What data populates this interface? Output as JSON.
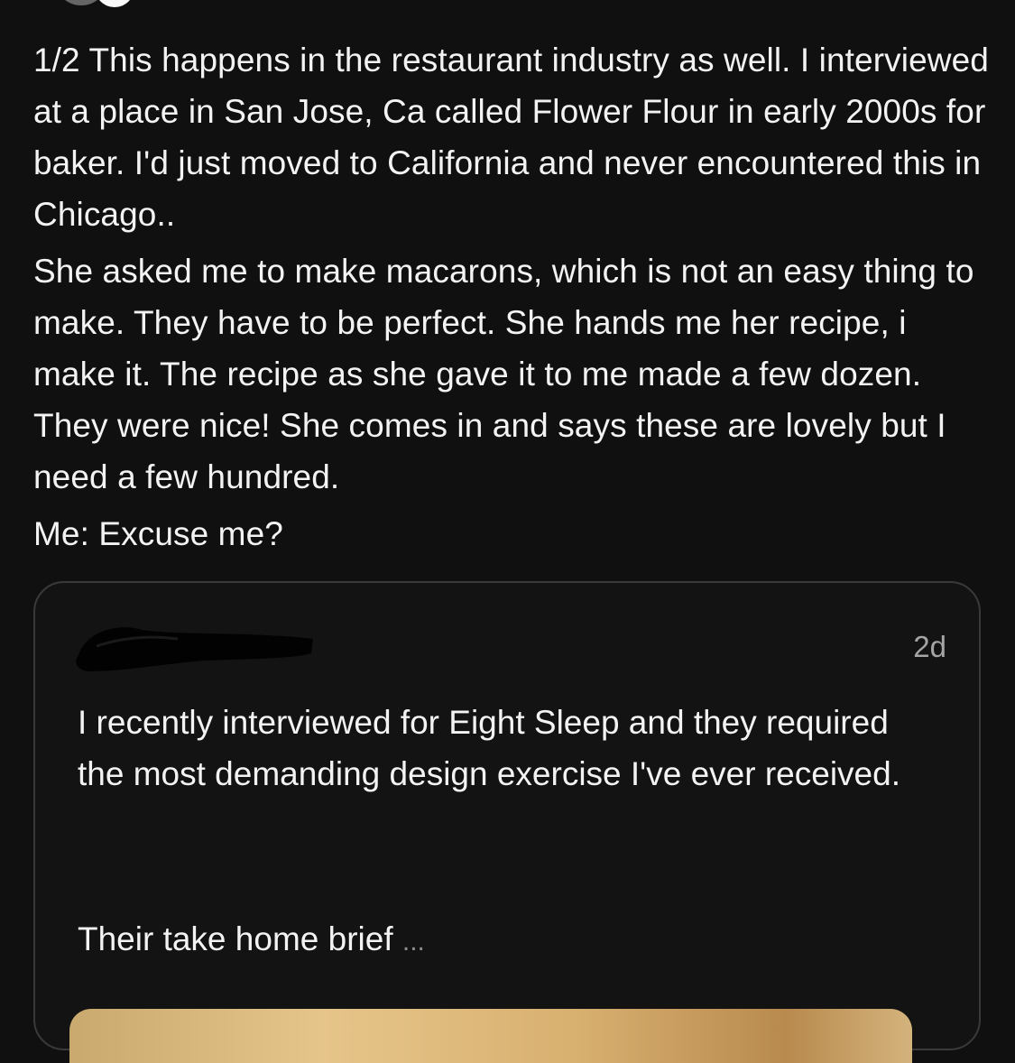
{
  "post": {
    "paragraphs": [
      "1/2 This happens in the restaurant industry as well. I interviewed at a place in San Jose, Ca called Flower Flour in early 2000s for baker. I'd just moved to California and never encountered this in Chicago..",
      "She asked me to make macarons, which is not an easy thing to make. They have to be perfect. She hands me her recipe, i make it. The recipe as she gave it to me made a few dozen. They were nice! She comes in and says these are lovely but I need a few hundred.",
      "Me: Excuse me?"
    ]
  },
  "quoted_post": {
    "timestamp": "2d",
    "text": "I recently interviewed for Eight Sleep and they required the most demanding design exercise I've ever received.",
    "text_continued": "Their take home brief",
    "truncation": "..."
  },
  "colors": {
    "background": "#101010",
    "text": "#f3f3f3",
    "muted": "#a5a5a5",
    "card_border": "#3a3a3a"
  }
}
